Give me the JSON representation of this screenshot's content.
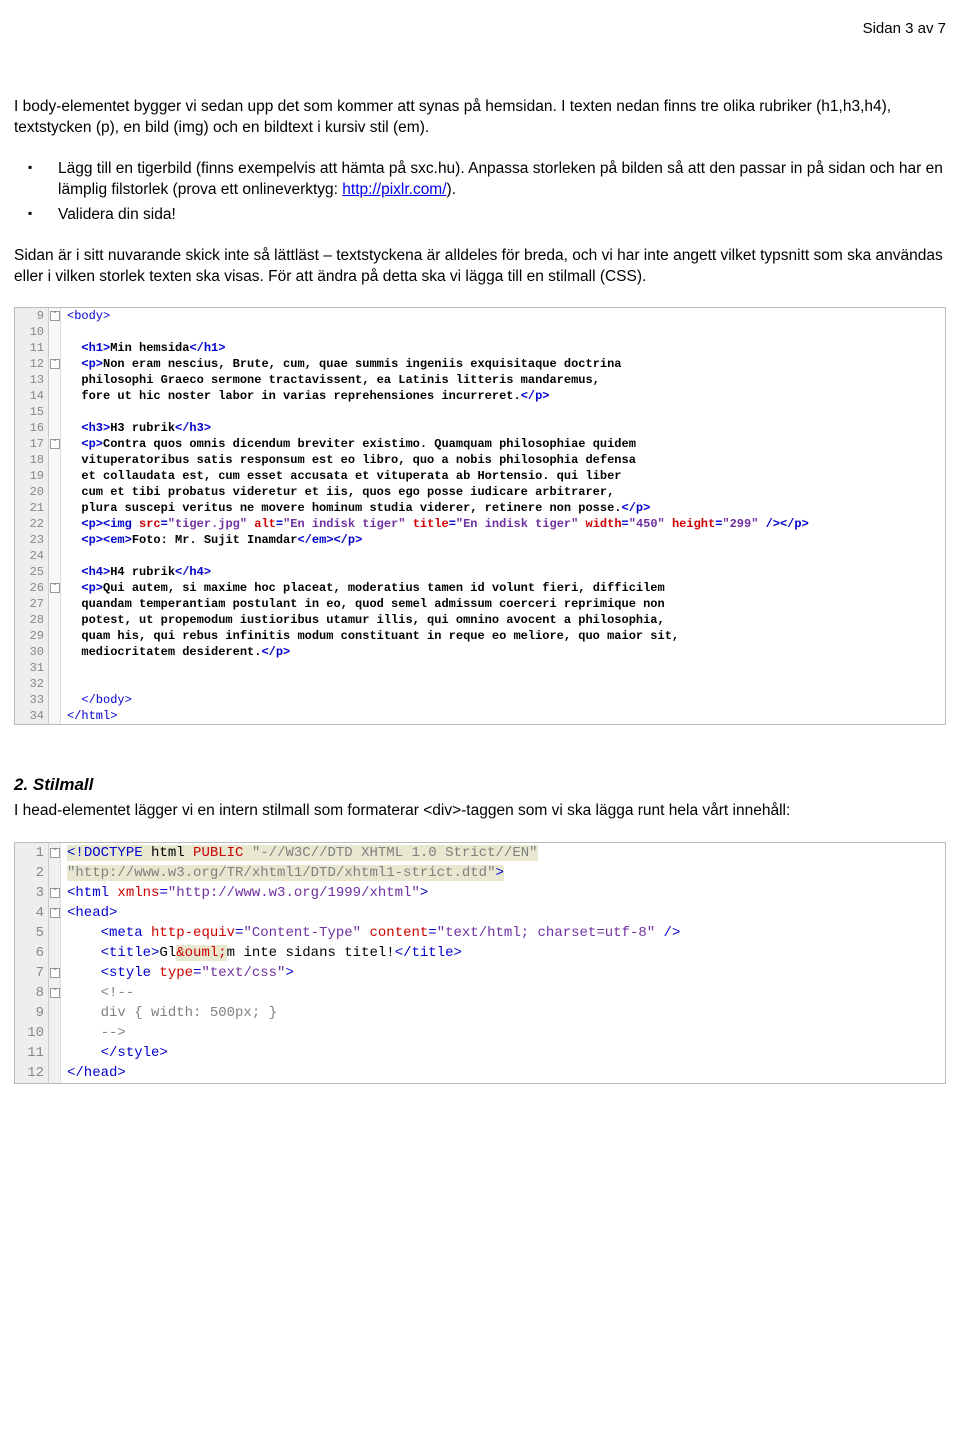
{
  "page_number": "Sidan 3 av 7",
  "para1": "I body-elementet bygger vi sedan upp det som kommer att synas på hemsidan. I texten nedan finns tre olika rubriker (h1,h3,h4), textstycken (p), en bild (img) och en bildtext i kursiv stil (em).",
  "bullet1a": "Lägg till en tigerbild (finns exempelvis att hämta på sxc.hu). Anpassa storleken på bilden så att den passar in på sidan och har en lämplig filstorlek (prova ett onlineverktyg: ",
  "bullet1_link": "http://pixlr.com/",
  "bullet1b": ").",
  "bullet2": "Validera din sida!",
  "para2": "Sidan är i sitt nuvarande skick inte så lättläst – textstyckena är alldeles för breda, och vi har inte angett vilket typsnitt som ska användas eller i vilken storlek texten ska visas. För att ändra på detta ska vi lägga till en stilmall (CSS).",
  "section2_title": "2. Stilmall",
  "section2_text": "I head-elementet lägger vi en intern stilmall som formaterar <div>-taggen som vi ska lägga runt hela vårt innehåll:",
  "code1": [
    {
      "n": "9",
      "fold": "box",
      "segs": [
        {
          "t": "<body>",
          "c": "c-blue"
        }
      ]
    },
    {
      "n": "10",
      "fold": "",
      "segs": []
    },
    {
      "n": "11",
      "fold": "",
      "bold": true,
      "segs": [
        {
          "t": "  ",
          "c": ""
        },
        {
          "t": "<h1>",
          "c": "c-blue"
        },
        {
          "t": "Min hemsida",
          "c": "c-black"
        },
        {
          "t": "</h1>",
          "c": "c-blue"
        }
      ]
    },
    {
      "n": "12",
      "fold": "box",
      "bold": true,
      "segs": [
        {
          "t": "  ",
          "c": ""
        },
        {
          "t": "<p>",
          "c": "c-blue"
        },
        {
          "t": "Non eram nescius, Brute, cum, quae summis ingeniis exquisitaque doctrina",
          "c": "c-black"
        }
      ]
    },
    {
      "n": "13",
      "fold": "",
      "bold": true,
      "segs": [
        {
          "t": "  philosophi Graeco sermone tractavissent, ea Latinis litteris mandaremus,",
          "c": "c-black"
        }
      ]
    },
    {
      "n": "14",
      "fold": "",
      "bold": true,
      "segs": [
        {
          "t": "  fore ut hic noster labor in varias reprehensiones incurreret.",
          "c": "c-black"
        },
        {
          "t": "</p>",
          "c": "c-blue"
        }
      ]
    },
    {
      "n": "15",
      "fold": "",
      "segs": []
    },
    {
      "n": "16",
      "fold": "",
      "bold": true,
      "segs": [
        {
          "t": "  ",
          "c": ""
        },
        {
          "t": "<h3>",
          "c": "c-blue"
        },
        {
          "t": "H3 rubrik",
          "c": "c-black"
        },
        {
          "t": "</h3>",
          "c": "c-blue"
        }
      ]
    },
    {
      "n": "17",
      "fold": "box",
      "bold": true,
      "segs": [
        {
          "t": "  ",
          "c": ""
        },
        {
          "t": "<p>",
          "c": "c-blue"
        },
        {
          "t": "Contra quos omnis dicendum breviter existimo. Quamquam philosophiae quidem",
          "c": "c-black"
        }
      ]
    },
    {
      "n": "18",
      "fold": "",
      "bold": true,
      "segs": [
        {
          "t": "  vituperatoribus satis responsum est eo libro, quo a nobis philosophia defensa",
          "c": "c-black"
        }
      ]
    },
    {
      "n": "19",
      "fold": "",
      "bold": true,
      "segs": [
        {
          "t": "  et collaudata est, cum esset accusata et vituperata ab Hortensio. qui liber",
          "c": "c-black"
        }
      ]
    },
    {
      "n": "20",
      "fold": "",
      "bold": true,
      "segs": [
        {
          "t": "  cum et tibi probatus videretur et iis, quos ego posse iudicare arbitrarer,",
          "c": "c-black"
        }
      ]
    },
    {
      "n": "21",
      "fold": "",
      "bold": true,
      "segs": [
        {
          "t": "  plura suscepi veritus ne movere hominum studia viderer, retinere non posse.",
          "c": "c-black"
        },
        {
          "t": "</p>",
          "c": "c-blue"
        }
      ]
    },
    {
      "n": "22",
      "fold": "",
      "bold": true,
      "segs": [
        {
          "t": "  ",
          "c": ""
        },
        {
          "t": "<p><img ",
          "c": "c-blue"
        },
        {
          "t": "src",
          "c": "c-red"
        },
        {
          "t": "=",
          "c": "c-blue"
        },
        {
          "t": "\"tiger.jpg\"",
          "c": "c-purple"
        },
        {
          "t": " ",
          "c": ""
        },
        {
          "t": "alt",
          "c": "c-red"
        },
        {
          "t": "=",
          "c": "c-blue"
        },
        {
          "t": "\"En indisk tiger\"",
          "c": "c-purple"
        },
        {
          "t": " ",
          "c": ""
        },
        {
          "t": "title",
          "c": "c-red"
        },
        {
          "t": "=",
          "c": "c-blue"
        },
        {
          "t": "\"En indisk tiger\"",
          "c": "c-purple"
        },
        {
          "t": " ",
          "c": ""
        },
        {
          "t": "width",
          "c": "c-red"
        },
        {
          "t": "=",
          "c": "c-blue"
        },
        {
          "t": "\"450\"",
          "c": "c-purple"
        },
        {
          "t": " ",
          "c": ""
        },
        {
          "t": "height",
          "c": "c-red"
        },
        {
          "t": "=",
          "c": "c-blue"
        },
        {
          "t": "\"299\"",
          "c": "c-purple"
        },
        {
          "t": " /></p>",
          "c": "c-blue"
        }
      ]
    },
    {
      "n": "23",
      "fold": "",
      "bold": true,
      "segs": [
        {
          "t": "  ",
          "c": ""
        },
        {
          "t": "<p><em>",
          "c": "c-blue"
        },
        {
          "t": "Foto: Mr. Sujit Inamdar",
          "c": "c-black"
        },
        {
          "t": "</em></p>",
          "c": "c-blue"
        }
      ]
    },
    {
      "n": "24",
      "fold": "",
      "segs": []
    },
    {
      "n": "25",
      "fold": "",
      "bold": true,
      "segs": [
        {
          "t": "  ",
          "c": ""
        },
        {
          "t": "<h4>",
          "c": "c-blue"
        },
        {
          "t": "H4 rubrik",
          "c": "c-black"
        },
        {
          "t": "</h4>",
          "c": "c-blue"
        }
      ]
    },
    {
      "n": "26",
      "fold": "box",
      "bold": true,
      "segs": [
        {
          "t": "  ",
          "c": ""
        },
        {
          "t": "<p>",
          "c": "c-blue"
        },
        {
          "t": "Qui autem, si maxime hoc placeat, moderatius tamen id volunt fieri, difficilem",
          "c": "c-black"
        }
      ]
    },
    {
      "n": "27",
      "fold": "",
      "bold": true,
      "segs": [
        {
          "t": "  quandam temperantiam postulant in eo, quod semel admissum coerceri reprimique non",
          "c": "c-black"
        }
      ]
    },
    {
      "n": "28",
      "fold": "",
      "bold": true,
      "segs": [
        {
          "t": "  potest, ut propemodum iustioribus utamur illis, qui omnino avocent a philosophia,",
          "c": "c-black"
        }
      ]
    },
    {
      "n": "29",
      "fold": "",
      "bold": true,
      "segs": [
        {
          "t": "  quam his, qui rebus infinitis modum constituant in reque eo meliore, quo maior sit,",
          "c": "c-black"
        }
      ]
    },
    {
      "n": "30",
      "fold": "",
      "bold": true,
      "segs": [
        {
          "t": "  mediocritatem desiderent.",
          "c": "c-black"
        },
        {
          "t": "</p>",
          "c": "c-blue"
        }
      ]
    },
    {
      "n": "31",
      "fold": "",
      "segs": []
    },
    {
      "n": "32",
      "fold": "",
      "segs": []
    },
    {
      "n": "33",
      "fold": "",
      "segs": [
        {
          "t": "  ",
          "c": ""
        },
        {
          "t": "</body>",
          "c": "c-blue"
        }
      ]
    },
    {
      "n": "34",
      "fold": "",
      "segs": [
        {
          "t": "</html>",
          "c": "c-blue"
        }
      ]
    }
  ],
  "code2": [
    {
      "n": "1",
      "fold": "box",
      "hl": true,
      "segs": [
        {
          "t": "<!",
          "c": "c-blue"
        },
        {
          "t": "DOCTYPE ",
          "c": "c-blue"
        },
        {
          "t": "html ",
          "c": "c-black"
        },
        {
          "t": "PUBLIC",
          "c": "c-red"
        },
        {
          "t": " \"-//W3C//DTD XHTML 1.0 Strict//EN\"",
          "c": "c-gray"
        }
      ]
    },
    {
      "n": "2",
      "fold": "",
      "hl": true,
      "segs": [
        {
          "t": "\"http://www.w3.org/TR/xhtml1/DTD/xhtml1-strict.dtd\"",
          "c": "c-gray"
        },
        {
          "t": ">",
          "c": "c-blue"
        }
      ]
    },
    {
      "n": "3",
      "fold": "box",
      "segs": [
        {
          "t": "<html ",
          "c": "c-blue"
        },
        {
          "t": "xmlns",
          "c": "c-red"
        },
        {
          "t": "=",
          "c": "c-blue"
        },
        {
          "t": "\"http://www.w3.org/1999/xhtml\"",
          "c": "c-purple"
        },
        {
          "t": ">",
          "c": "c-blue"
        }
      ]
    },
    {
      "n": "4",
      "fold": "box",
      "segs": [
        {
          "t": "<head>",
          "c": "c-blue"
        }
      ]
    },
    {
      "n": "5",
      "fold": "",
      "segs": [
        {
          "t": "    ",
          "c": ""
        },
        {
          "t": "<meta ",
          "c": "c-blue"
        },
        {
          "t": "http-equiv",
          "c": "c-red"
        },
        {
          "t": "=",
          "c": "c-blue"
        },
        {
          "t": "\"Content-Type\"",
          "c": "c-purple"
        },
        {
          "t": " ",
          "c": ""
        },
        {
          "t": "content",
          "c": "c-red"
        },
        {
          "t": "=",
          "c": "c-blue"
        },
        {
          "t": "\"text/html; charset=utf-8\"",
          "c": "c-purple"
        },
        {
          "t": " />",
          "c": "c-blue"
        }
      ]
    },
    {
      "n": "6",
      "fold": "",
      "segs": [
        {
          "t": "    ",
          "c": ""
        },
        {
          "t": "<title>",
          "c": "c-blue"
        },
        {
          "t": "Gl",
          "c": "c-black"
        },
        {
          "t": "&ouml;",
          "c": "c-red",
          "hl": true
        },
        {
          "t": "m inte sidans titel!",
          "c": "c-black"
        },
        {
          "t": "</title>",
          "c": "c-blue"
        }
      ]
    },
    {
      "n": "7",
      "fold": "box",
      "segs": [
        {
          "t": "    ",
          "c": ""
        },
        {
          "t": "<style ",
          "c": "c-blue"
        },
        {
          "t": "type",
          "c": "c-red"
        },
        {
          "t": "=",
          "c": "c-blue"
        },
        {
          "t": "\"text/css\"",
          "c": "c-purple"
        },
        {
          "t": ">",
          "c": "c-blue"
        }
      ]
    },
    {
      "n": "8",
      "fold": "box",
      "segs": [
        {
          "t": "    ",
          "c": ""
        },
        {
          "t": "<!--",
          "c": "c-gray"
        }
      ]
    },
    {
      "n": "9",
      "fold": "",
      "segs": [
        {
          "t": "    div { width: 500px; }",
          "c": "c-gray"
        }
      ]
    },
    {
      "n": "10",
      "fold": "",
      "segs": [
        {
          "t": "    ",
          "c": ""
        },
        {
          "t": "-->",
          "c": "c-gray"
        }
      ]
    },
    {
      "n": "11",
      "fold": "",
      "segs": [
        {
          "t": "    ",
          "c": ""
        },
        {
          "t": "</style>",
          "c": "c-blue"
        }
      ]
    },
    {
      "n": "12",
      "fold": "",
      "segs": [
        {
          "t": "</head>",
          "c": "c-blue"
        }
      ]
    }
  ]
}
